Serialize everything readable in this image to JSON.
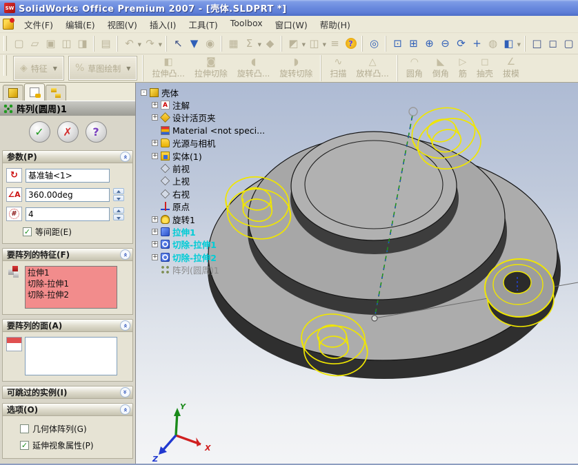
{
  "window": {
    "title": "SolidWorks Office Premium 2007 - [壳体.SLDPRT *]",
    "app_logo": "SW"
  },
  "menu": {
    "items": [
      "文件(F)",
      "编辑(E)",
      "视图(V)",
      "插入(I)",
      "工具(T)",
      "Toolbox",
      "窗口(W)",
      "帮助(H)"
    ]
  },
  "standard_toolbar": {
    "groups": [
      {
        "icons": [
          {
            "name": "new-document-icon",
            "glyph": "▢"
          },
          {
            "name": "open-icon",
            "glyph": "▱"
          },
          {
            "name": "save-icon",
            "glyph": "▣"
          },
          {
            "name": "make-drawing-icon",
            "glyph": "◫"
          },
          {
            "name": "make-assembly-icon",
            "glyph": "◨"
          }
        ]
      },
      {
        "icons": [
          {
            "name": "print-icon",
            "glyph": "▤"
          }
        ]
      },
      {
        "icons": [
          {
            "name": "undo-icon",
            "glyph": "↶",
            "caret": true
          },
          {
            "name": "redo-icon",
            "glyph": "↷",
            "caret": true
          }
        ]
      },
      {
        "icons": [
          {
            "name": "select-icon",
            "glyph": "↖",
            "style": "dark"
          },
          {
            "name": "selection-filter-icon",
            "glyph": "▼",
            "style": "blue"
          },
          {
            "name": "toggle-selection-icon",
            "glyph": "◉"
          }
        ]
      },
      {
        "icons": [
          {
            "name": "grid-icon",
            "glyph": "▦"
          },
          {
            "name": "dimension-icon",
            "glyph": "Σ",
            "caret": true
          },
          {
            "name": "rebuild-icon",
            "glyph": "◆"
          }
        ]
      },
      {
        "icons": [
          {
            "name": "section-view-icon",
            "glyph": "◩",
            "caret": true
          },
          {
            "name": "split-window-icon",
            "glyph": "◫",
            "caret": true
          },
          {
            "name": "options-icon",
            "glyph": "≡"
          },
          {
            "name": "help-icon",
            "glyph": "?",
            "style": "help"
          }
        ]
      },
      {
        "icons": [
          {
            "name": "view-orientation-icon",
            "glyph": "◎",
            "style": "blue"
          }
        ]
      },
      {
        "icons": [
          {
            "name": "zoom-to-fit-icon",
            "glyph": "⊡",
            "style": "blue"
          },
          {
            "name": "zoom-to-area-icon",
            "glyph": "⊞",
            "style": "blue"
          },
          {
            "name": "zoom-in-out-icon",
            "glyph": "⊕",
            "style": "blue"
          },
          {
            "name": "zoom-to-selection-icon",
            "glyph": "⊖",
            "style": "blue"
          },
          {
            "name": "rotate-view-icon",
            "glyph": "⟳",
            "style": "blue"
          },
          {
            "name": "pan-icon",
            "glyph": "+",
            "style": "blue"
          },
          {
            "name": "hide-show-icon",
            "glyph": "◍"
          },
          {
            "name": "display-style-icon",
            "glyph": "◧",
            "style": "blue",
            "caret": true
          }
        ]
      },
      {
        "icons": [
          {
            "name": "wireframe-view-icon",
            "glyph": "□",
            "style": "dark"
          },
          {
            "name": "hidden-lines-visible-icon",
            "glyph": "◻",
            "style": "dark"
          },
          {
            "name": "shaded-view-icon",
            "glyph": "▢",
            "style": "dark"
          }
        ]
      }
    ]
  },
  "feature_toolbar": {
    "groups": [
      {
        "big": true,
        "items": [
          {
            "label": "特征",
            "icon": "features-flyout-icon",
            "glyph": "◈",
            "dropdown": true
          },
          {
            "label": "草图绘制",
            "icon": "sketch-flyout-icon",
            "glyph": "%",
            "dropdown": true
          }
        ]
      },
      {
        "items": [
          {
            "label": "拉伸凸...",
            "icon": "extruded-boss-icon",
            "glyph": "◧"
          },
          {
            "label": "拉伸切除",
            "icon": "extruded-cut-icon",
            "glyph": "◙"
          },
          {
            "label": "旋转凸...",
            "icon": "revolved-boss-icon",
            "glyph": "◖"
          },
          {
            "label": "旋转切除",
            "icon": "revolved-cut-icon",
            "glyph": "◗"
          }
        ]
      },
      {
        "items": [
          {
            "label": "扫描",
            "icon": "sweep-icon",
            "glyph": "∿"
          },
          {
            "label": "放样凸...",
            "icon": "loft-icon",
            "glyph": "△"
          }
        ]
      },
      {
        "items": [
          {
            "label": "圆角",
            "icon": "fillet-icon",
            "glyph": "◠"
          },
          {
            "label": "倒角",
            "icon": "chamfer-icon",
            "glyph": "◣"
          },
          {
            "label": "筋",
            "icon": "rib-icon",
            "glyph": "▷"
          },
          {
            "label": "抽壳",
            "icon": "shell-icon",
            "glyph": "◻"
          },
          {
            "label": "拔模",
            "icon": "draft-icon",
            "glyph": "∠"
          }
        ]
      }
    ]
  },
  "property_manager": {
    "title": "阵列(圆周)1",
    "parameters": {
      "label": "参数(P)",
      "axis_value": "基准轴<1>",
      "angle_value": "360.00deg",
      "count_value": "4",
      "equal_spacing": {
        "label": "等间距(E)",
        "checked": true
      }
    },
    "features_to_pattern": {
      "label": "要阵列的特征(F)",
      "items": [
        "拉伸1",
        "切除-拉伸1",
        "切除-拉伸2"
      ]
    },
    "faces_to_pattern": {
      "label": "要阵列的面(A)",
      "items": []
    },
    "instances_to_skip": {
      "label": "可跳过的实例(I)"
    },
    "options": {
      "label": "选项(O)",
      "geometry_pattern": {
        "label": "几何体阵列(G)",
        "checked": false
      },
      "propagate_visual": {
        "label": "延伸视象属性(P)",
        "checked": true
      }
    }
  },
  "feature_tree": {
    "items": [
      {
        "label": "壳体",
        "icon": "part",
        "expander": "-",
        "level": 0
      },
      {
        "label": "注解",
        "icon": "annotations",
        "glyph": "A",
        "expander": "+",
        "level": 1
      },
      {
        "label": "设计活页夹",
        "icon": "design-binder",
        "expander": "+",
        "level": 1
      },
      {
        "label": "Material <not speci...",
        "icon": "material",
        "level": 1
      },
      {
        "label": "光源与相机",
        "icon": "lights",
        "expander": "+",
        "level": 1
      },
      {
        "label": "实体(1)",
        "icon": "solid-bodies",
        "expander": "+",
        "level": 1
      },
      {
        "label": "前视",
        "icon": "plane",
        "level": 1
      },
      {
        "label": "上视",
        "icon": "plane",
        "level": 1
      },
      {
        "label": "右视",
        "icon": "plane",
        "level": 1
      },
      {
        "label": "原点",
        "icon": "origin",
        "level": 1
      },
      {
        "label": "旋转1",
        "icon": "revolve",
        "expander": "+",
        "level": 1
      },
      {
        "label": "拉伸1",
        "icon": "extrude",
        "expander": "+",
        "level": 1,
        "state": "selected"
      },
      {
        "label": "切除-拉伸1",
        "icon": "cut-extrude",
        "expander": "+",
        "level": 1,
        "state": "selected"
      },
      {
        "label": "切除-拉伸2",
        "icon": "cut-extrude",
        "expander": "+",
        "level": 1,
        "state": "selected"
      },
      {
        "label": "阵列(圆周)1",
        "icon": "circular-pattern",
        "level": 1,
        "state": "pending"
      }
    ]
  },
  "viewport": {
    "triad": {
      "x": "X",
      "y": "Y",
      "z": "Z"
    }
  },
  "colors": {
    "titlebar_blue": "#6B8BDE",
    "toolbar_beige": "#ECE9D8",
    "selection_cyan": "#00CCD6",
    "preview_yellow": "#F0E600",
    "selected_list_pink": "#F28C8C",
    "viewport_gradient_top": "#AEBBD4",
    "viewport_gradient_bottom": "#F3F4F6",
    "model_gray": "#ACACAC"
  }
}
